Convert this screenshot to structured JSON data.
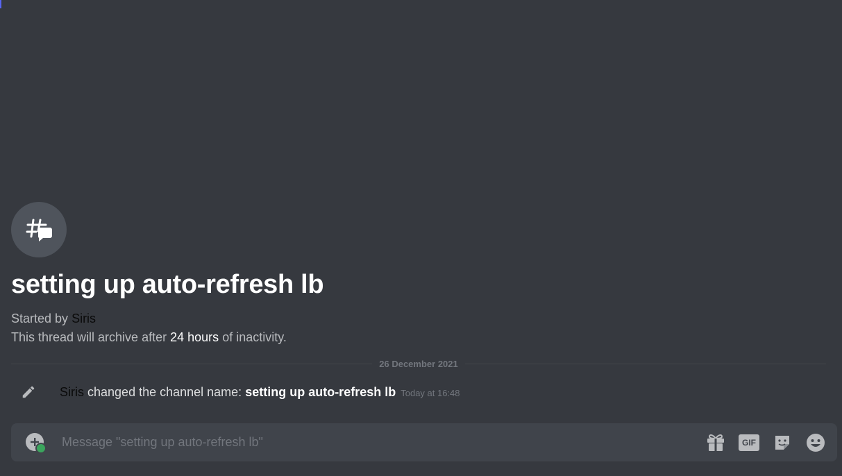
{
  "thread": {
    "title": "setting up auto-refresh lb",
    "started_prefix": "Started by",
    "started_user": "Siris",
    "archive_prefix": "This thread will archive after",
    "archive_duration": "24 hours",
    "archive_suffix": "of inactivity."
  },
  "divider": {
    "date": "26 December 2021"
  },
  "system_message": {
    "user": "Siris",
    "action": "changed the channel name:",
    "new_name": "setting up auto-refresh lb",
    "timestamp": "Today at 16:48"
  },
  "composer": {
    "placeholder": "Message \"setting up auto-refresh lb\"",
    "gif_label": "GIF"
  },
  "icons": {
    "thread": "thread-icon",
    "pencil": "pencil-icon",
    "attach": "add-attachment-icon",
    "gift": "gift-icon",
    "gif": "gif-icon",
    "sticker": "sticker-icon",
    "emoji": "emoji-icon"
  },
  "colors": {
    "background": "#36393f",
    "composer": "#40444b",
    "accent_green": "#3ba55d",
    "muted_text": "#72767d"
  }
}
